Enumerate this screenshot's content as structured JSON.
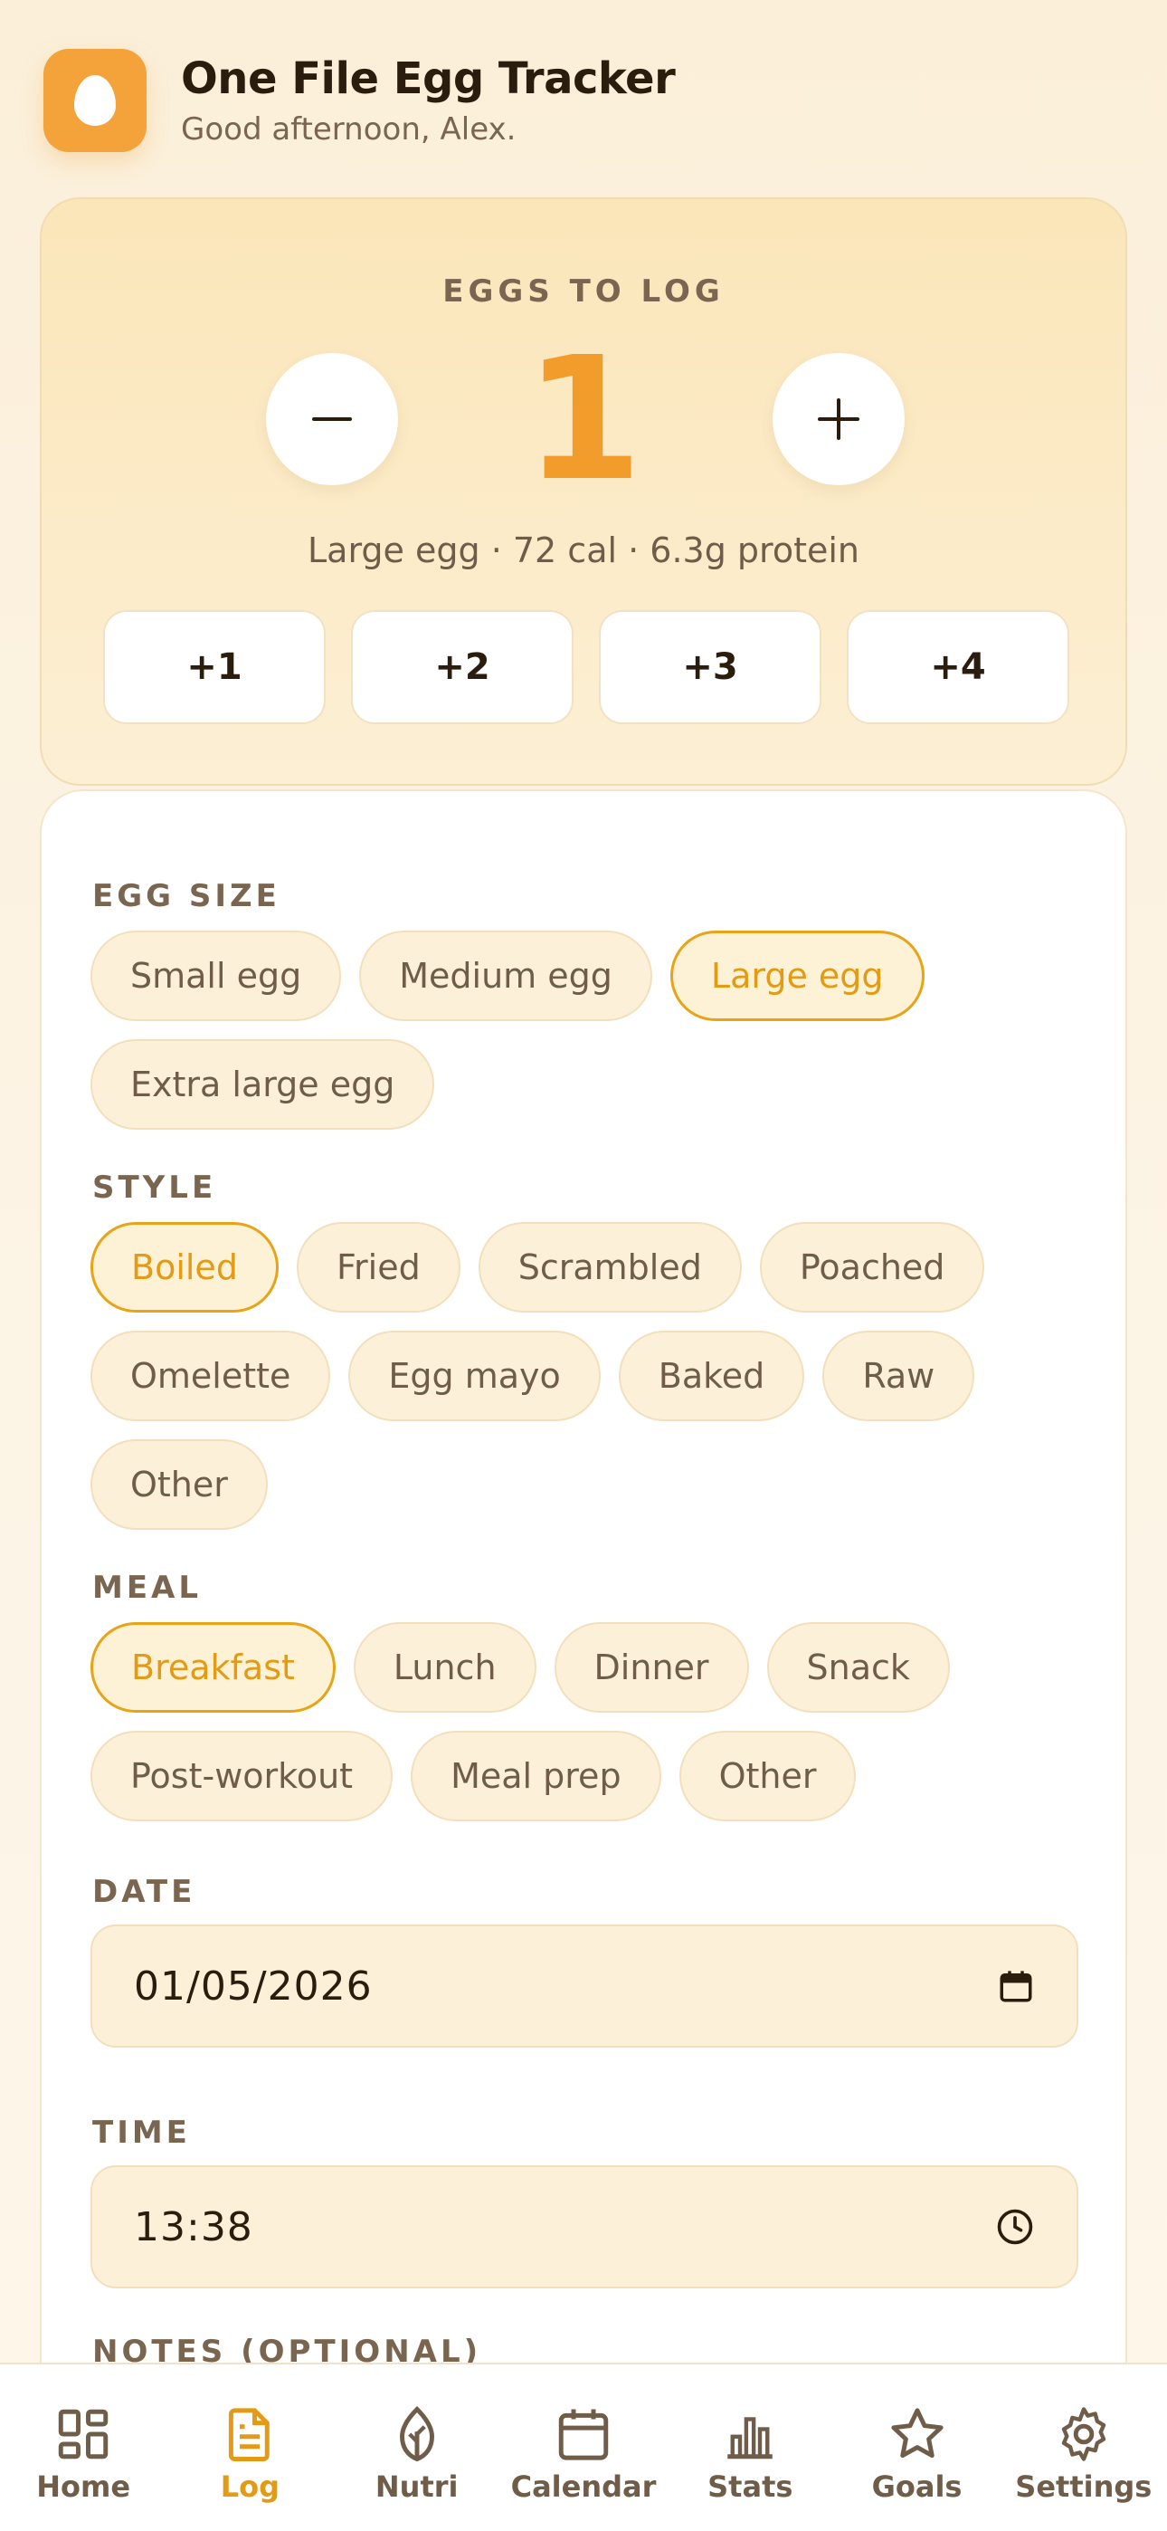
{
  "header": {
    "app_icon": "egg-icon",
    "title": "One File Egg Tracker",
    "greeting": "Good afternoon, Alex."
  },
  "counter": {
    "label": "EGGS TO LOG",
    "value": "1",
    "minus_label": "−",
    "plus_label": "+",
    "info": "Large egg · 72 cal · 6.3g protein",
    "quick_add": [
      "+1",
      "+2",
      "+3",
      "+4"
    ]
  },
  "form": {
    "egg_size": {
      "label": "EGG SIZE",
      "options": [
        "Small egg",
        "Medium egg",
        "Large egg",
        "Extra large egg"
      ],
      "selected": "Large egg"
    },
    "style": {
      "label": "STYLE",
      "options": [
        "Boiled",
        "Fried",
        "Scrambled",
        "Poached",
        "Omelette",
        "Egg mayo",
        "Baked",
        "Raw",
        "Other"
      ],
      "selected": "Boiled"
    },
    "meal": {
      "label": "MEAL",
      "options": [
        "Breakfast",
        "Lunch",
        "Dinner",
        "Snack",
        "Post-workout",
        "Meal prep",
        "Other"
      ],
      "selected": "Breakfast"
    },
    "date": {
      "label": "DATE",
      "value": "01/05/2026",
      "icon": "calendar-icon"
    },
    "time": {
      "label": "TIME",
      "value": "13:38",
      "icon": "clock-icon"
    },
    "notes": {
      "label": "NOTES (OPTIONAL)"
    }
  },
  "nav": {
    "items": [
      {
        "label": "Home",
        "icon": "grid-icon"
      },
      {
        "label": "Log",
        "icon": "document-icon"
      },
      {
        "label": "Nutri",
        "icon": "leaf-icon"
      },
      {
        "label": "Calendar",
        "icon": "calendar-icon"
      },
      {
        "label": "Stats",
        "icon": "bar-chart-icon"
      },
      {
        "label": "Goals",
        "icon": "star-icon"
      },
      {
        "label": "Settings",
        "icon": "gear-icon"
      }
    ],
    "active": "Log"
  },
  "colors": {
    "accent": "#f29d2b",
    "selected_chip": "#e39a14"
  }
}
